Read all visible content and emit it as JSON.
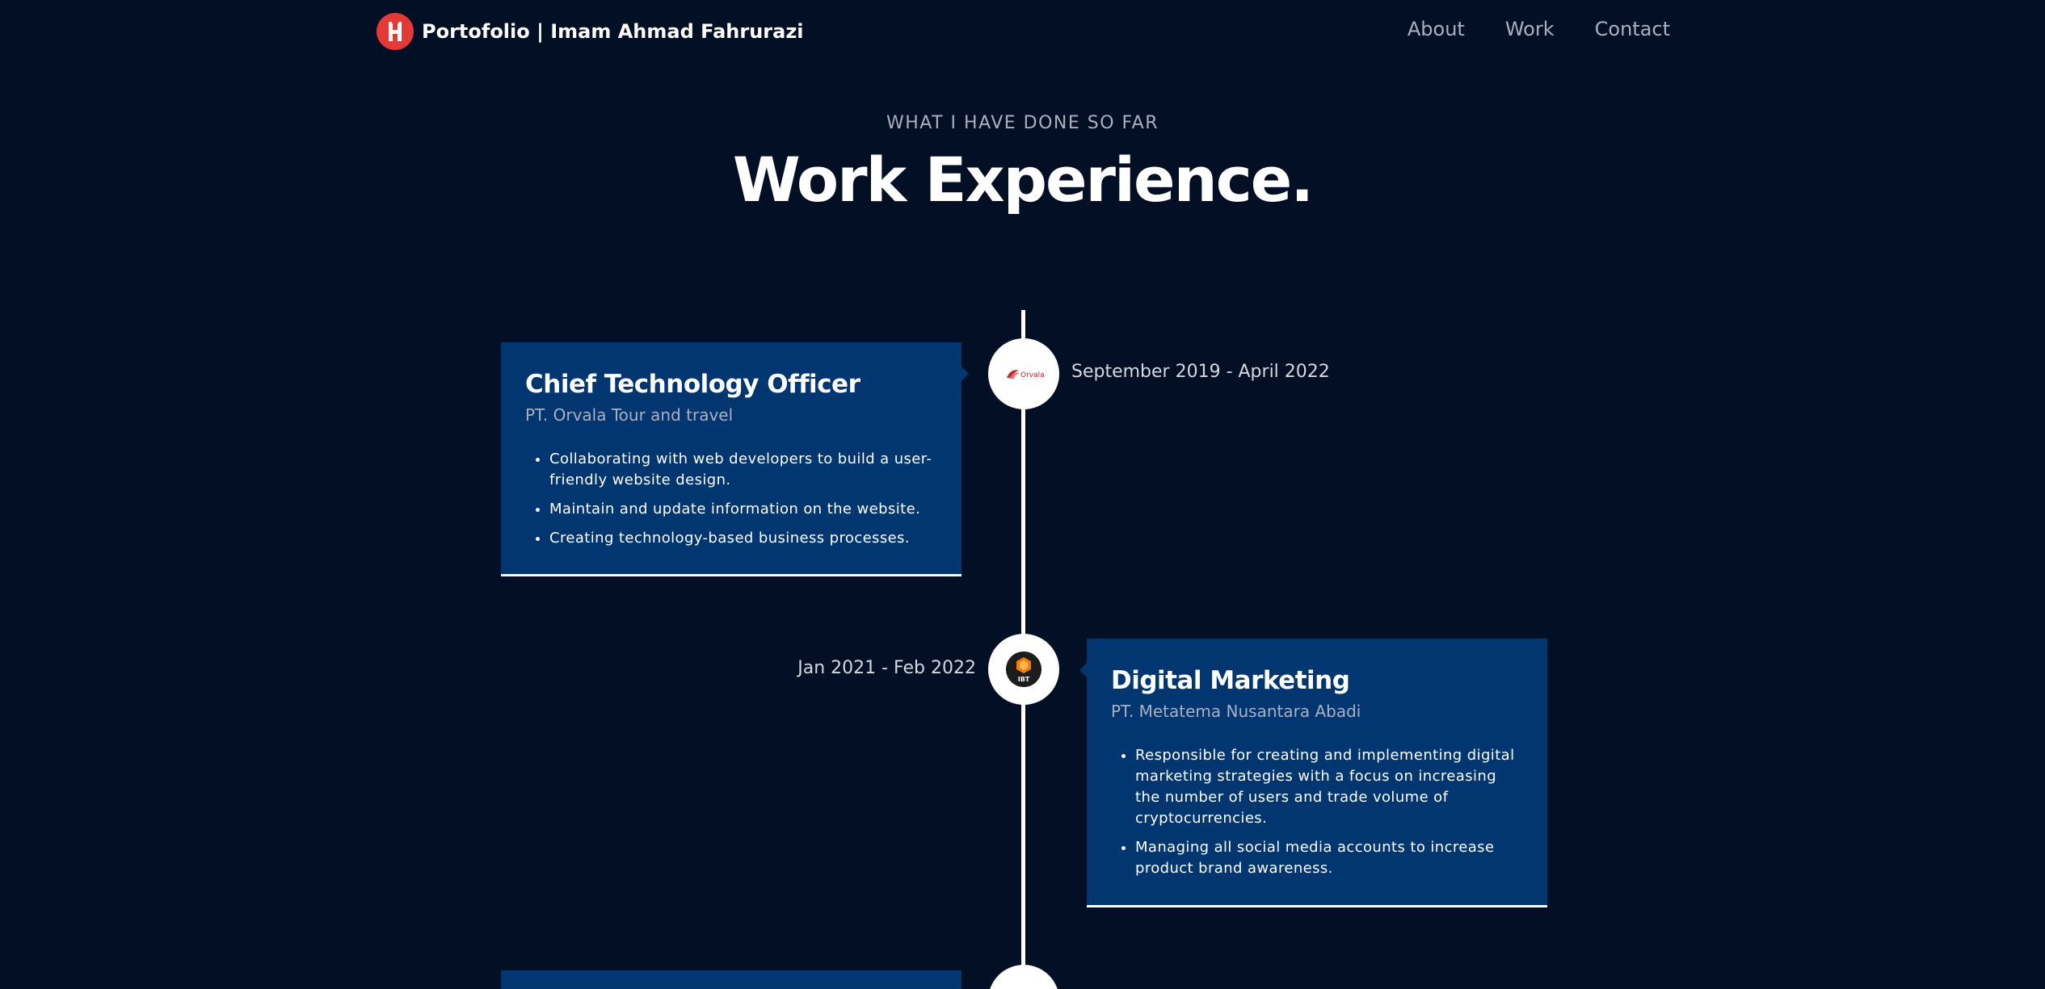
{
  "nav": {
    "brand": "Portofolio  | Imam Ahmad Fahrurazi",
    "links": [
      "About",
      "Work",
      "Contact"
    ]
  },
  "header": {
    "subtitle": "WHAT I HAVE DONE SO FAR",
    "title": "Work Experience."
  },
  "experiences": [
    {
      "title": "Chief Technology Officer",
      "company": "PT. Orvala Tour and travel",
      "date": "September 2019 - April 2022",
      "icon": "orvala-logo-icon",
      "logo_text": "Orvala",
      "points": [
        "Collaborating with web developers to build a user-friendly website design.",
        "Maintain and update information on the website.",
        "Creating technology-based business processes."
      ]
    },
    {
      "title": "Digital Marketing",
      "company": "PT. Metatema Nusantara Abadi",
      "date": "Jan 2021 - Feb 2022",
      "icon": "ibt-logo-icon",
      "logo_text": "IBT",
      "points": [
        "Responsible for creating and implementing digital marketing strategies with a focus on increasing the number of users and trade volume of cryptocurrencies.",
        "Managing all social media accounts to increase product brand awareness."
      ]
    }
  ],
  "colors": {
    "background": "#030f24",
    "card": "#023671",
    "accent": "#e53935",
    "muted": "#aab0bf"
  }
}
